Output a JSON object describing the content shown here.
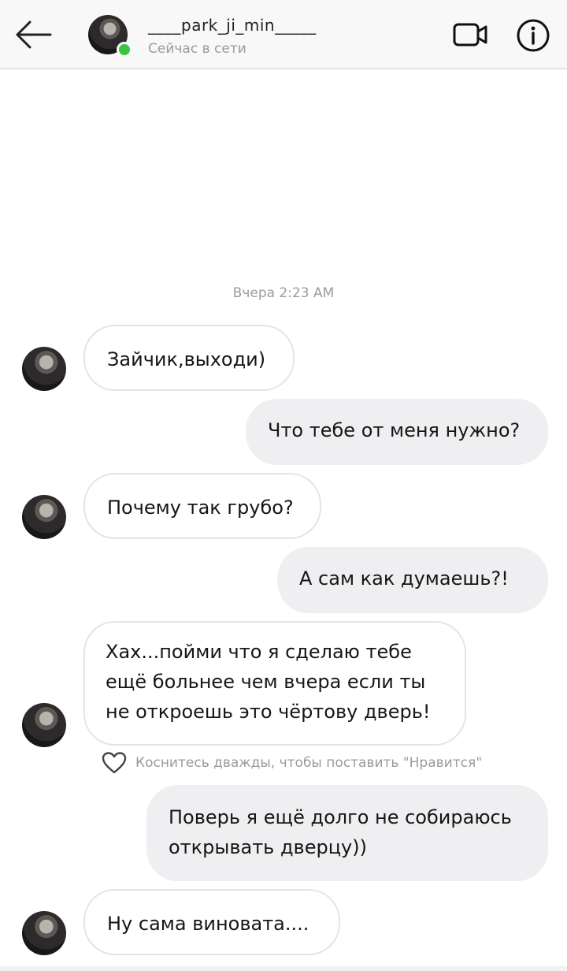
{
  "header": {
    "back_icon": "arrow-left-icon",
    "username": "____park_ji_min_____",
    "status": "Сейчас в сети",
    "video_icon": "video-camera-icon",
    "info_icon": "info-icon",
    "online_color": "#3bc43f"
  },
  "chat": {
    "timestamp": "Вчера 2:23 AM",
    "messages": [
      {
        "side": "in",
        "text": "Зайчик,выходи)"
      },
      {
        "side": "out",
        "text": "Что тебе от меня нужно?"
      },
      {
        "side": "in",
        "text": "Почему так грубо?"
      },
      {
        "side": "out",
        "text": "А сам  как думаешь?!"
      },
      {
        "side": "in",
        "text": "Хах...пойми что я сделаю тебе ещё больнее чем вчера если ты не откроешь это чёртову дверь!"
      },
      {
        "side": "out",
        "text": "Поверь я ещё долго не собираюсь открывать дверцу))"
      },
      {
        "side": "in",
        "text": "Ну сама виновата...."
      }
    ],
    "like_hint": "Коснитесь дважды, чтобы поставить \"Нравится\"",
    "like_icon": "heart-icon"
  }
}
